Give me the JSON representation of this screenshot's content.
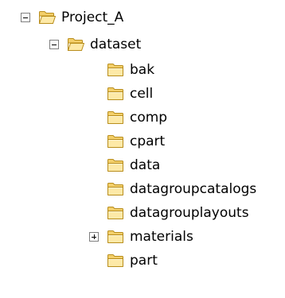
{
  "tree": {
    "root": {
      "label": "Project_A",
      "expanded": true,
      "icon": "folder-open-icon"
    },
    "dataset": {
      "label": "dataset",
      "expanded": true,
      "icon": "folder-open-icon"
    },
    "children": [
      {
        "label": "bak",
        "icon": "folder-icon"
      },
      {
        "label": "cell",
        "icon": "folder-icon"
      },
      {
        "label": "comp",
        "icon": "folder-icon"
      },
      {
        "label": "cpart",
        "icon": "folder-icon"
      },
      {
        "label": "data",
        "icon": "folder-icon"
      },
      {
        "label": "datagroupcatalogs",
        "icon": "folder-icon"
      },
      {
        "label": "datagrouplayouts",
        "icon": "folder-icon"
      },
      {
        "label": "materials",
        "icon": "folder-icon",
        "expandable": true,
        "expanded": false
      },
      {
        "label": "part",
        "icon": "folder-icon"
      }
    ]
  },
  "colors": {
    "folder_fill": "#f5d77e",
    "folder_front": "#fce8a8",
    "folder_outline": "#b88d1c",
    "toggle_border": "#7f7f7f"
  }
}
